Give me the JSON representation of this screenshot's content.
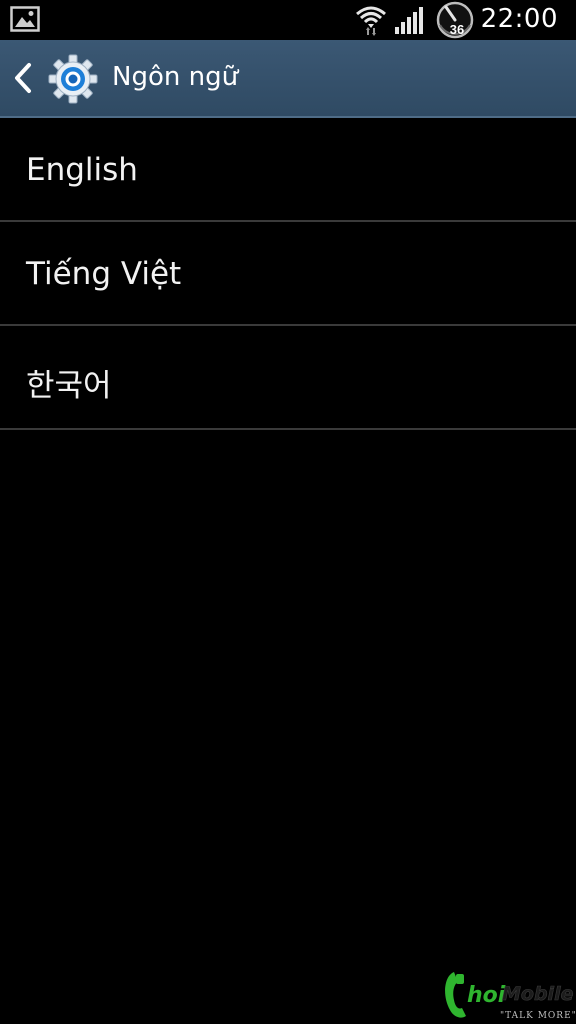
{
  "status_bar": {
    "time": "22:00",
    "battery_level": "36",
    "icons": [
      "gallery-icon",
      "wifi-icon",
      "signal-icon",
      "battery-gauge-icon"
    ]
  },
  "action_bar": {
    "title": "Ngôn ngữ",
    "back_icon": "chevron-left-icon",
    "app_icon": "settings-gear-icon"
  },
  "languages": [
    {
      "label": "English"
    },
    {
      "label": "Tiếng Việt"
    },
    {
      "label": "한국어"
    }
  ],
  "watermark": {
    "brand": "ChoiMobile",
    "tagline": "\"TALK MORE\""
  },
  "colors": {
    "action_bar": "#35506b",
    "background": "#000000",
    "divider": "#3a3a3a",
    "gear_blue": "#1e7fd8",
    "watermark_green": "#2fb52f"
  }
}
